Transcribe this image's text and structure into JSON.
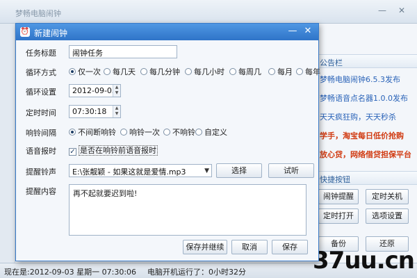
{
  "main": {
    "title": "梦畅电脑闹钟",
    "sidebar_header": "公告栏",
    "news": [
      {
        "text": "梦畅电脑闹钟6.5.3发布",
        "hot": false
      },
      {
        "text": "梦畅语音点名器1.0.0发布",
        "hot": false
      },
      {
        "text": "天天疯狂购，天天秒杀",
        "hot": false
      },
      {
        "text": "学手，淘宝每日低价抢购",
        "hot": true
      },
      {
        "text": "放心贷，网络借贷担保平台",
        "hot": true
      }
    ],
    "shortcut_header": "快捷按钮",
    "shortcuts": [
      "闹钟提醒",
      "定时关机",
      "定时打开",
      "选项设置",
      "备份",
      "还原"
    ],
    "status_time": "现在是:2012-09-03 星期一 07:30:06",
    "status_runtime": "电脑开机运行了：0小时32分"
  },
  "dialog": {
    "title": "新建闹钟",
    "fields": {
      "task_title_label": "任务标题",
      "task_title_value": "闹钟任务",
      "cycle_label": "循环方式",
      "cycle_options": [
        "仅一次",
        "每几天",
        "每几分钟",
        "每几小时",
        "每周几",
        "每月",
        "每年"
      ],
      "cycle_selected": 0,
      "cycle_setting_label": "循环设置",
      "cycle_setting_value": "2012-09-03",
      "time_label": "定时时间",
      "time_value": "07:30:18",
      "ring_interval_label": "响铃间隔",
      "ring_options": [
        "不间断响铃",
        "响铃一次",
        "不响铃",
        "自定义"
      ],
      "ring_selected": 0,
      "voice_label": "语音报时",
      "voice_checkbox_label": "是否在响铃前语音报时",
      "voice_checked": true,
      "ringtone_label": "提醒铃声",
      "ringtone_value": "E:\\张靓颖 - 如果这就是爱情.mp3",
      "select_button": "选择",
      "preview_button": "试听",
      "content_label": "提醒内容",
      "content_value": "再不起就要迟到啦!"
    },
    "buttons": {
      "save_continue": "保存并继续",
      "cancel": "取消",
      "save": "保存"
    }
  },
  "watermark": "37uu.cn",
  "colors": {
    "titlebar_blue": "#2f74c8",
    "link_blue": "#2a63b8",
    "hot_red": "#d13b12"
  }
}
